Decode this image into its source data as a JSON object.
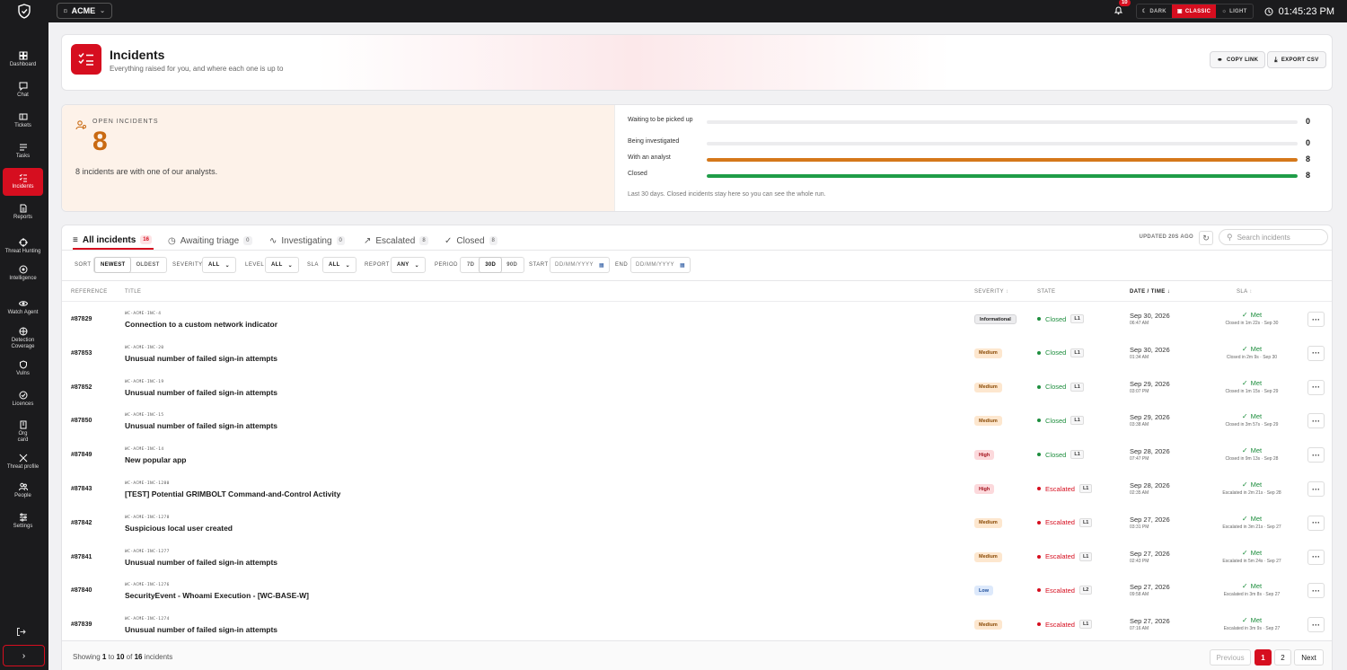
{
  "topbar": {
    "tenant": "ACME",
    "notifications_count": "10",
    "themes": [
      {
        "label": "DARK",
        "active": false
      },
      {
        "label": "CLASSIC",
        "active": true
      },
      {
        "label": "LIGHT",
        "active": false
      }
    ],
    "time": "01:45:23 PM"
  },
  "sidebar": {
    "items": [
      {
        "label": "Dashboard",
        "icon": "dashboard-icon"
      },
      {
        "label": "Chat",
        "icon": "chat-icon"
      },
      {
        "label": "Tickets",
        "icon": "ticket-icon"
      },
      {
        "label": "Tasks",
        "icon": "tasks-icon"
      },
      {
        "label": "Incidents",
        "icon": "incidents-icon",
        "active": true
      },
      {
        "label": "Reports",
        "icon": "report-icon"
      },
      {
        "label": "Threat Hunting",
        "icon": "crosshair-icon"
      },
      {
        "label": "Intelligence",
        "icon": "intelligence-icon"
      },
      {
        "label": "Watch Agent",
        "icon": "eye-icon"
      },
      {
        "label": "Detection Coverage",
        "icon": "shield-grid-icon"
      },
      {
        "label": "Vulns",
        "icon": "shield-icon"
      },
      {
        "label": "Licences",
        "icon": "check-circle-icon"
      },
      {
        "label": "Org card",
        "icon": "building-icon"
      },
      {
        "label": "Threat profile",
        "icon": "crossed-swords-icon"
      },
      {
        "label": "People",
        "icon": "people-icon"
      },
      {
        "label": "Settings",
        "icon": "sliders-icon"
      }
    ]
  },
  "header": {
    "title": "Incidents",
    "subtitle": "Everything raised for you, and where each one is up to",
    "copy_link": "COPY LINK",
    "export_csv": "EXPORT CSV"
  },
  "summary": {
    "open_label": "OPEN INCIDENTS",
    "open_count": "8",
    "description": "8 incidents are with one of our analysts.",
    "bars": [
      {
        "label": "Waiting to be picked up",
        "value": "0",
        "fraction": 0,
        "color": "#c8c8cc"
      },
      {
        "label": "Being investigated",
        "value": "0",
        "fraction": 0,
        "color": "#c8c8cc"
      },
      {
        "label": "With an analyst",
        "value": "8",
        "fraction": 1,
        "color": "#d5781a"
      },
      {
        "label": "Closed",
        "value": "8",
        "fraction": 1,
        "color": "#1f9d48"
      }
    ],
    "footnote": "Last 30 days. Closed incidents stay here so you can see the whole run."
  },
  "tabs": [
    {
      "label": "All incidents",
      "count": "16",
      "active": true
    },
    {
      "label": "Awaiting triage",
      "count": "0"
    },
    {
      "label": "Investigating",
      "count": "0"
    },
    {
      "label": "Escalated",
      "count": "8"
    },
    {
      "label": "Closed",
      "count": "8"
    }
  ],
  "toolbar": {
    "updated": "UPDATED 20S AGO",
    "search_placeholder": "Search incidents"
  },
  "filters": {
    "sort_label": "SORT",
    "sort_options": [
      "NEWEST",
      "OLDEST"
    ],
    "severity_label": "SEVERITY",
    "severity_value": "ALL",
    "level_label": "LEVEL",
    "level_value": "ALL",
    "sla_label": "SLA",
    "sla_value": "ALL",
    "report_label": "REPORT",
    "report_value": "ANY",
    "period_label": "PERIOD",
    "period_options": [
      "7D",
      "30D",
      "90D"
    ],
    "start_label": "START",
    "end_label": "END",
    "date_placeholder": "DD/MM/YYYY"
  },
  "columns": {
    "reference": "REFERENCE",
    "title": "TITLE",
    "severity": "SEVERITY",
    "state": "STATE",
    "datetime": "DATE / TIME",
    "sla": "SLA"
  },
  "colors": {
    "accent": "#d60e1f",
    "closed": "#1e8e3e",
    "escalated": "#d60e1f"
  },
  "incidents": [
    {
      "ref": "#87829",
      "code": "WC-ACME-INC-4",
      "title": "Connection to a custom network indicator",
      "severity": "Informational",
      "sev_key": "informational",
      "state": "Closed",
      "level": "L1",
      "date": "Sep 30, 2026",
      "time": "06:47 AM",
      "sla": "Met",
      "sla_detail": "Closed in 1m 22s · Sep 30"
    },
    {
      "ref": "#87853",
      "code": "WC-ACME-INC-20",
      "title": "Unusual number of failed sign-in attempts",
      "severity": "Medium",
      "sev_key": "medium",
      "state": "Closed",
      "level": "L1",
      "date": "Sep 30, 2026",
      "time": "01:34 AM",
      "sla": "Met",
      "sla_detail": "Closed in 2m 9s · Sep 30"
    },
    {
      "ref": "#87852",
      "code": "WC-ACME-INC-19",
      "title": "Unusual number of failed sign-in attempts",
      "severity": "Medium",
      "sev_key": "medium",
      "state": "Closed",
      "level": "L1",
      "date": "Sep 29, 2026",
      "time": "03:07 PM",
      "sla": "Met",
      "sla_detail": "Closed in 1m 15s · Sep 29"
    },
    {
      "ref": "#87850",
      "code": "WC-ACME-INC-15",
      "title": "Unusual number of failed sign-in attempts",
      "severity": "Medium",
      "sev_key": "medium",
      "state": "Closed",
      "level": "L1",
      "date": "Sep 29, 2026",
      "time": "03:38 AM",
      "sla": "Met",
      "sla_detail": "Closed in 3m 57s · Sep 29"
    },
    {
      "ref": "#87849",
      "code": "WC-ACME-INC-14",
      "title": "New popular app",
      "severity": "High",
      "sev_key": "high",
      "state": "Closed",
      "level": "L1",
      "date": "Sep 28, 2026",
      "time": "07:47 PM",
      "sla": "Met",
      "sla_detail": "Closed in 9m 13s · Sep 28"
    },
    {
      "ref": "#87843",
      "code": "WC-ACME-INC-1280",
      "title": "[TEST] Potential GRIMBOLT Command-and-Control Activity",
      "severity": "High",
      "sev_key": "high",
      "state": "Escalated",
      "level": "L1",
      "date": "Sep 28, 2026",
      "time": "02:35 AM",
      "sla": "Met",
      "sla_detail": "Escalated in 2m 21s · Sep 28"
    },
    {
      "ref": "#87842",
      "code": "WC-ACME-INC-1278",
      "title": "Suspicious local user created",
      "severity": "Medium",
      "sev_key": "medium",
      "state": "Escalated",
      "level": "L1",
      "date": "Sep 27, 2026",
      "time": "03:31 PM",
      "sla": "Met",
      "sla_detail": "Escalated in 3m 21s · Sep 27"
    },
    {
      "ref": "#87841",
      "code": "WC-ACME-INC-1277",
      "title": "Unusual number of failed sign-in attempts",
      "severity": "Medium",
      "sev_key": "medium",
      "state": "Escalated",
      "level": "L1",
      "date": "Sep 27, 2026",
      "time": "02:43 PM",
      "sla": "Met",
      "sla_detail": "Escalated in 5m 24s · Sep 27"
    },
    {
      "ref": "#87840",
      "code": "WC-ACME-INC-1276",
      "title": "SecurityEvent - Whoami Execution - [WC-BASE-W]",
      "severity": "Low",
      "sev_key": "low",
      "state": "Escalated",
      "level": "L2",
      "date": "Sep 27, 2026",
      "time": "09:58 AM",
      "sla": "Met",
      "sla_detail": "Escalated in 3m 8s · Sep 27"
    },
    {
      "ref": "#87839",
      "code": "WC-ACME-INC-1274",
      "title": "Unusual number of failed sign-in attempts",
      "severity": "Medium",
      "sev_key": "medium",
      "state": "Escalated",
      "level": "L1",
      "date": "Sep 27, 2026",
      "time": "07:16 AM",
      "sla": "Met",
      "sla_detail": "Escalated in 3m 9s · Sep 27"
    }
  ],
  "pagination": {
    "showing": "Showing",
    "from": "1",
    "to_word": "to",
    "to": "10",
    "of_word": "of",
    "total": "16",
    "unit": "incidents",
    "previous": "Previous",
    "pages": [
      "1",
      "2"
    ],
    "next": "Next"
  }
}
